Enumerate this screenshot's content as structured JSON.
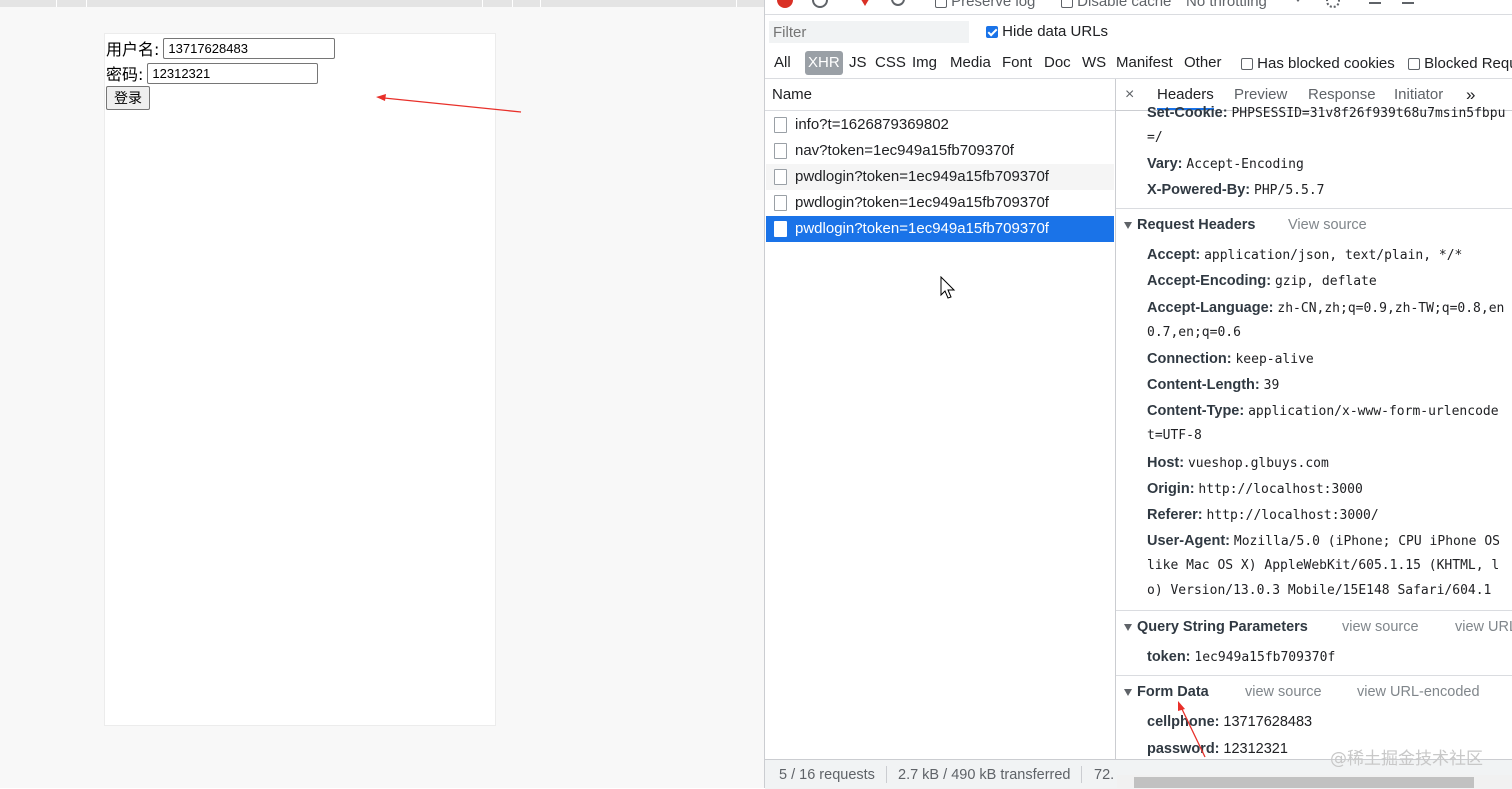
{
  "form": {
    "username_label": "用户名:",
    "username_value": "13717628483",
    "password_label": "密码:",
    "password_value": "12312321",
    "login_button": "登录"
  },
  "toolbar": {
    "preserve_log": "Preserve log",
    "disable_cache": "Disable cache",
    "throttling": "No throttling",
    "filter_placeholder": "Filter",
    "hide_data_urls": "Hide data URLs",
    "types": [
      "All",
      "XHR",
      "JS",
      "CSS",
      "Img",
      "Media",
      "Font",
      "Doc",
      "WS",
      "Manifest",
      "Other"
    ],
    "active_type": "XHR",
    "has_blocked_cookies": "Has blocked cookies",
    "blocked_requests": "Blocked Requ"
  },
  "list": {
    "header": "Name",
    "rows": [
      "info?t=1626879369802",
      "nav?token=1ec949a15fb709370f",
      "pwdlogin?token=1ec949a15fb709370f",
      "pwdlogin?token=1ec949a15fb709370f",
      "pwdlogin?token=1ec949a15fb709370f"
    ],
    "selected_index": 4
  },
  "detail": {
    "close": "×",
    "tabs": [
      "Headers",
      "Preview",
      "Response",
      "Initiator"
    ],
    "more": "»",
    "response_top": {
      "set_cookie_label": "Set-Cookie:",
      "set_cookie_value": "PHPSESSID=31v8f26f939t68u7msin5fbpu",
      "set_cookie_cont": "=/",
      "vary_label": "Vary:",
      "vary_value": "Accept-Encoding",
      "xpb_label": "X-Powered-By:",
      "xpb_value": "PHP/5.5.7"
    },
    "request_headers_title": "Request Headers",
    "view_source": "View source",
    "request_headers": {
      "accept_label": "Accept:",
      "accept_value": "application/json, text/plain, */*",
      "encoding_label": "Accept-Encoding:",
      "encoding_value": "gzip, deflate",
      "language_label": "Accept-Language:",
      "language_value": "zh-CN,zh;q=0.9,zh-TW;q=0.8,en",
      "language_cont": "0.7,en;q=0.6",
      "connection_label": "Connection:",
      "connection_value": "keep-alive",
      "length_label": "Content-Length:",
      "length_value": "39",
      "type_label": "Content-Type:",
      "type_value": "application/x-www-form-urlencode",
      "type_cont": "t=UTF-8",
      "host_label": "Host:",
      "host_value": "vueshop.glbuys.com",
      "origin_label": "Origin:",
      "origin_value": "http://localhost:3000",
      "referer_label": "Referer:",
      "referer_value": "http://localhost:3000/",
      "ua_label": "User-Agent:",
      "ua_value": "Mozilla/5.0 (iPhone; CPU iPhone OS",
      "ua_cont1": "like Mac OS X) AppleWebKit/605.1.15 (KHTML, l",
      "ua_cont2": "o) Version/13.0.3 Mobile/15E148 Safari/604.1"
    },
    "query_title": "Query String Parameters",
    "query_view_source": "view source",
    "query_view_url": "view URL",
    "query": {
      "token_label": "token:",
      "token_value": "1ec949a15fb709370f"
    },
    "form_title": "Form Data",
    "form_view_source": "view source",
    "form_view_url": "view URL-encoded",
    "form_data": {
      "cellphone_label": "cellphone:",
      "cellphone_value": "13717628483",
      "password_label": "password:",
      "password_value": "12312321"
    }
  },
  "status": {
    "requests": "5 / 16 requests",
    "transferred": "2.7 kB / 490 kB transferred",
    "resources": "72."
  },
  "watermark": "@稀土掘金技术社区",
  "colors": {
    "accent": "#1a73e8",
    "arrow": "#e8302a"
  }
}
